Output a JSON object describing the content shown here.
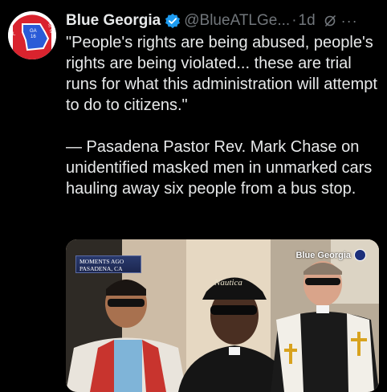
{
  "tweet": {
    "author_name": "Blue Georgia",
    "handle": "@BlueATLGe...",
    "separator": "·",
    "time": "1d",
    "more": "···",
    "paragraphs": [
      "\"People's rights are being abused, people's rights are being violated... these are trial runs for what this administration will attempt to do to citizens.\"",
      "— Pasadena Pastor Rev. Mark Chase on unidentified masked men in unmarked cars hauling away six people from a bus stop."
    ]
  },
  "avatar": {
    "labels": [
      "AL",
      "GA",
      "16",
      "SC",
      "9"
    ]
  },
  "media": {
    "chyron_line1": "MOMENTS AGO",
    "chyron_line2": "PASADENA, CA",
    "watermark": "Blue Georgia",
    "hat_text": "Nautica"
  },
  "colors": {
    "accent": "#1d9bf0",
    "avatar_red": "#d9232e",
    "background": "#000000"
  }
}
